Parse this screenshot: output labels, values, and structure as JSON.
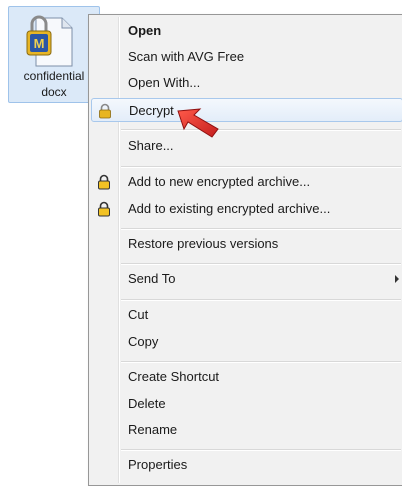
{
  "file": {
    "name_line1": "confidential",
    "name_line2": "docx",
    "icon": "lock-document-icon"
  },
  "menu": {
    "items": [
      {
        "label": "Open",
        "bold": true
      },
      {
        "label": "Scan with AVG Free"
      },
      {
        "label": "Open With..."
      },
      {
        "label": "Decrypt",
        "icon": "lock-icon",
        "hover": true
      },
      {
        "label": "Share..."
      },
      {
        "label": "Add to new encrypted archive...",
        "icon": "lock-icon"
      },
      {
        "label": "Add to existing encrypted archive...",
        "icon": "lock-icon"
      },
      {
        "label": "Restore previous versions"
      },
      {
        "label": "Send To",
        "submenu": true
      },
      {
        "label": "Cut"
      },
      {
        "label": "Copy"
      },
      {
        "label": "Create Shortcut"
      },
      {
        "label": "Delete"
      },
      {
        "label": "Rename"
      },
      {
        "label": "Properties"
      }
    ]
  },
  "colors": {
    "hover_border": "#a8c8ec",
    "selection_bg": "#dbe9f8",
    "pointer_arrow": "#e03030"
  }
}
